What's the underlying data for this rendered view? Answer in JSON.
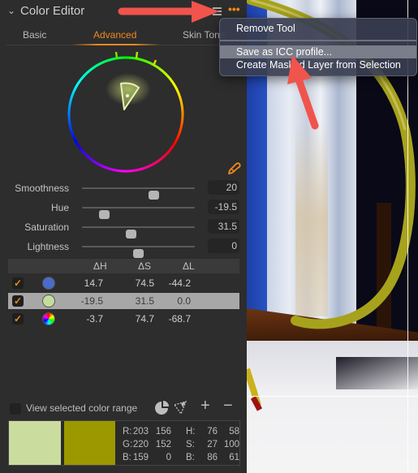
{
  "panel": {
    "title": "Color Editor",
    "collapse_icon": "chevron-down-icon",
    "list_icon": "list-icon",
    "more_label": "•••"
  },
  "tabs": [
    {
      "label": "Basic",
      "active": false
    },
    {
      "label": "Advanced",
      "active": true
    },
    {
      "label": "Skin Tone",
      "active": false
    }
  ],
  "sliders": [
    {
      "label": "Smoothness",
      "value": "20",
      "position": 0.64
    },
    {
      "label": "Hue",
      "value": "-19.5",
      "position": 0.2
    },
    {
      "label": "Saturation",
      "value": "31.5",
      "position": 0.44
    },
    {
      "label": "Lightness",
      "value": "0",
      "position": 0.5
    }
  ],
  "table": {
    "headers": [
      "ΔH",
      "ΔS",
      "ΔL"
    ],
    "rows": [
      {
        "checked": true,
        "swatch": "#4a6bc8",
        "dh": "14.7",
        "ds": "74.5",
        "dl": "-44.2",
        "selected": false
      },
      {
        "checked": true,
        "swatch": "#c6dc9c",
        "dh": "-19.5",
        "ds": "31.5",
        "dl": "0.0",
        "selected": true
      },
      {
        "checked": true,
        "swatch": "rainbow",
        "dh": "-3.7",
        "ds": "74.7",
        "dl": "-68.7",
        "selected": false
      }
    ]
  },
  "bottom": {
    "view_range_label": "View selected color range",
    "view_range_checked": false,
    "plus_label": "+",
    "minus_label": "−"
  },
  "color_info": {
    "swatch_before": "#cbdc9f",
    "swatch_after": "#9c9800",
    "rgb": {
      "R": [
        "203",
        "156"
      ],
      "G": [
        "220",
        "152"
      ],
      "B": [
        "159",
        "0"
      ]
    },
    "hsb": {
      "H": [
        "76",
        "58"
      ],
      "S": [
        "27",
        "100"
      ],
      "B": [
        "86",
        "61"
      ]
    }
  },
  "menu": {
    "items": [
      {
        "label": "Remove Tool"
      },
      {
        "label": "Save as ICC profile...",
        "highlighted": true
      },
      {
        "label": "Create Masked Layer from Selection"
      }
    ]
  },
  "colors": {
    "accent": "#f08a1c",
    "annotation_arrow": "#f0544c"
  }
}
